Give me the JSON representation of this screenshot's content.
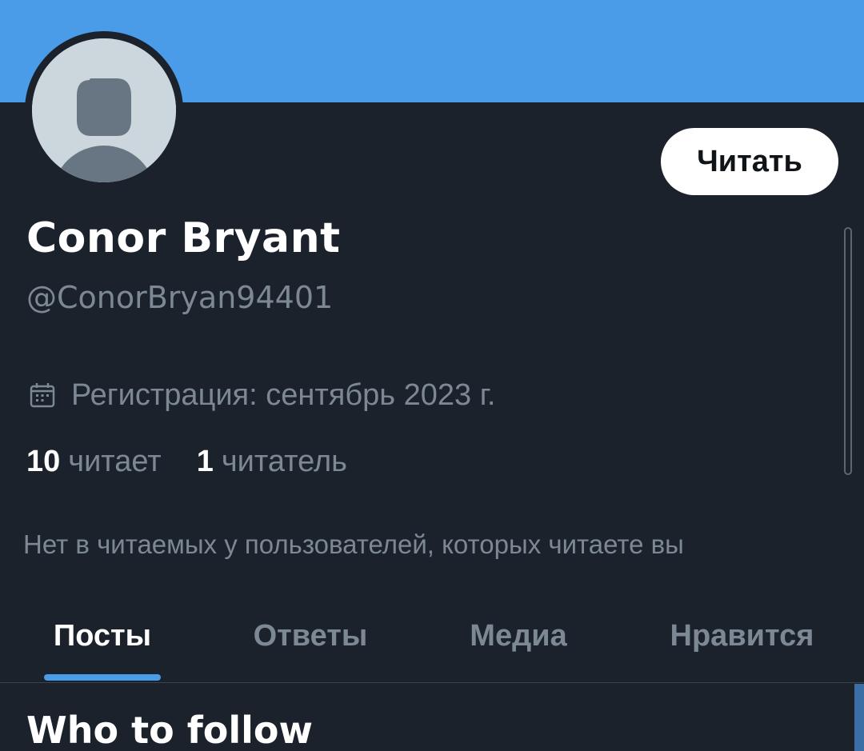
{
  "banner": {
    "color": "#4b9ce8"
  },
  "profile": {
    "avatar_icon": "default-avatar-icon",
    "display_name": "Conor Bryant",
    "handle": "@ConorBryan94401",
    "joined": {
      "icon": "calendar-icon",
      "text": "Регистрация: сентябрь 2023 г."
    },
    "stats": {
      "following_count": "10",
      "following_label": "читает",
      "followers_count": "1",
      "followers_label": "читатель"
    },
    "mutual_note": "Нет в читаемых у пользователей, которых читаете вы"
  },
  "actions": {
    "follow_label": "Читать"
  },
  "tabs": [
    {
      "label": "Посты",
      "active": true
    },
    {
      "label": "Ответы",
      "active": false
    },
    {
      "label": "Медиа",
      "active": false
    },
    {
      "label": "Нравится",
      "active": false
    }
  ],
  "section": {
    "title": "Who to follow"
  },
  "colors": {
    "background": "#1b222c",
    "accent": "#4b9ce8",
    "secondary_text": "#7c8894"
  }
}
